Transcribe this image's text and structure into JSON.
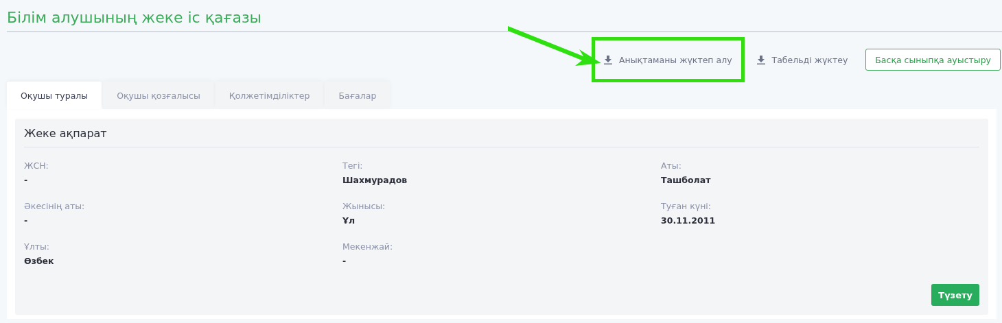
{
  "page_title": "Білім алушының жеке іс қағазы",
  "actions": [
    {
      "kind": "download",
      "label": "Анықтаманы жүктеп алу",
      "highlighted": true
    },
    {
      "kind": "download",
      "label": "Табельді жүктеу",
      "highlighted": false
    },
    {
      "kind": "outline",
      "label": "Басқа сыныпқа ауыстыру",
      "highlighted": false
    }
  ],
  "tabs": [
    {
      "label": "Оқушы туралы",
      "selected": true
    },
    {
      "label": "Оқушы қозғалысы",
      "selected": false
    },
    {
      "label": "Қолжетімділіктер",
      "selected": false
    },
    {
      "label": "Бағалар",
      "selected": false
    }
  ],
  "section": {
    "title": "Жеке ақпарат",
    "fields": [
      {
        "label": "ЖСН:",
        "value": "-"
      },
      {
        "label": "Тегі:",
        "value": "Шахмурадов"
      },
      {
        "label": "Аты:",
        "value": "Ташболат"
      },
      {
        "label": "Әкесінің аты:",
        "value": "-"
      },
      {
        "label": "Жынысы:",
        "value": "Ұл"
      },
      {
        "label": "Туған күні:",
        "value": "30.11.2011"
      },
      {
        "label": "Ұлты:",
        "value": "Өзбек"
      },
      {
        "label": "Мекенжай:",
        "value": "-"
      }
    ],
    "button": "Түзету"
  }
}
